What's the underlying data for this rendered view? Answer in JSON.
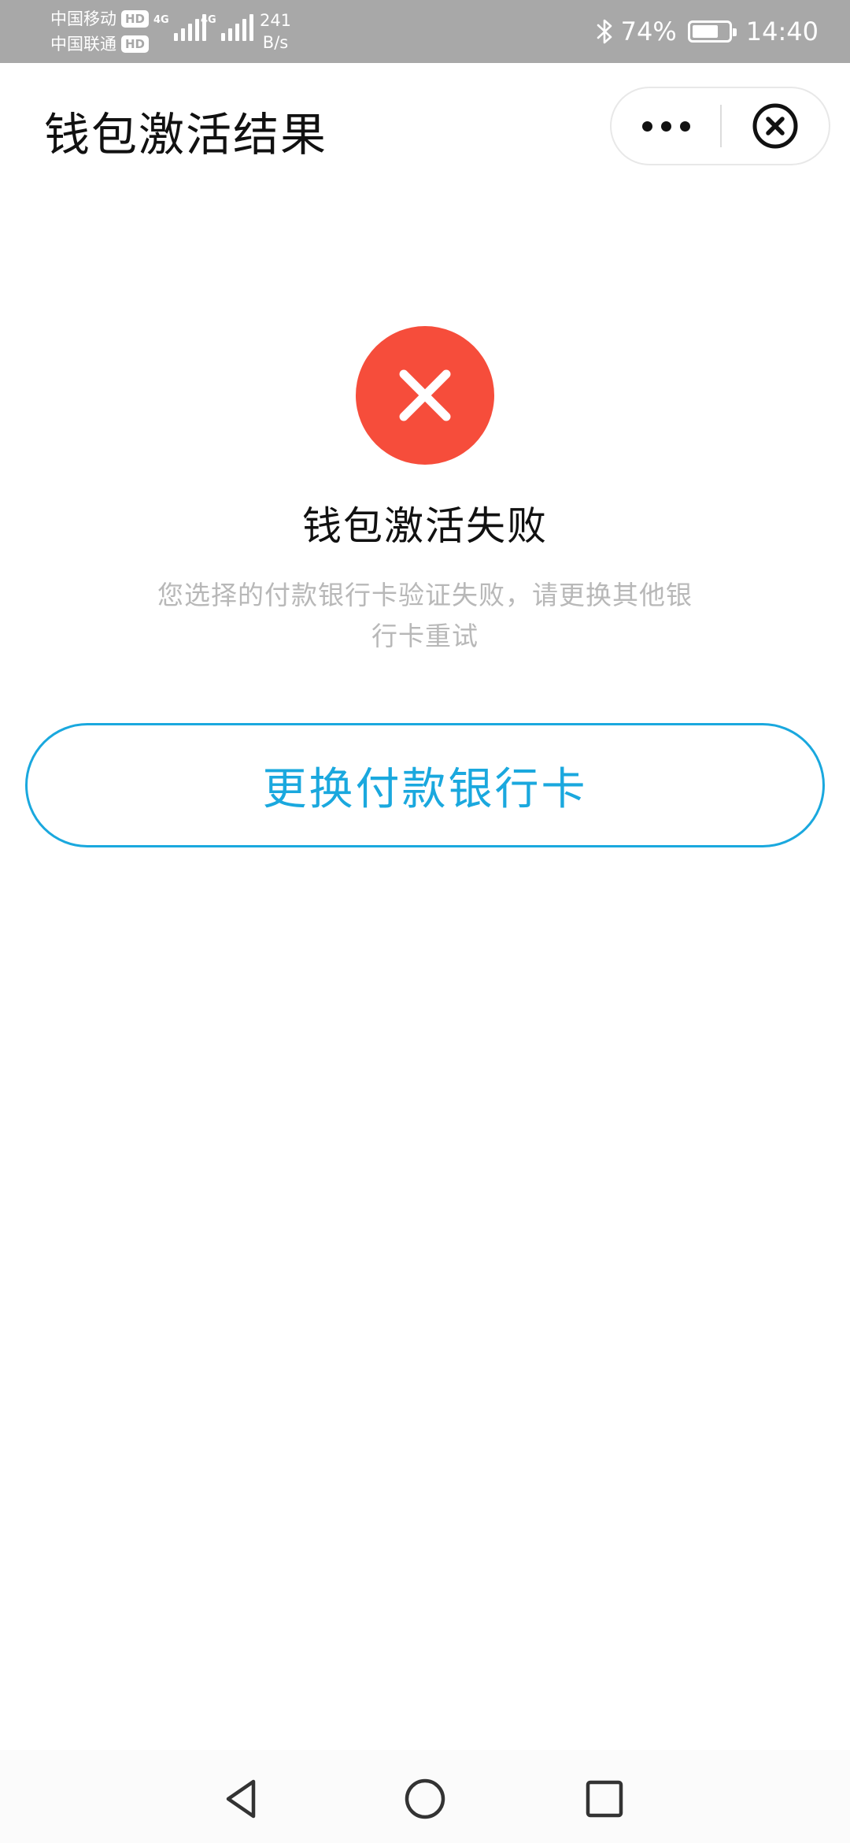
{
  "status_bar": {
    "carrier_1": "中国移动",
    "carrier_2": "中国联通",
    "hd_badge": "HD",
    "network_1": "4G",
    "network_2": "4G",
    "speed_value": "241",
    "speed_unit": "B/s",
    "battery_level": 0.74,
    "battery_text": "74%",
    "time": "14:40"
  },
  "title_bar": {
    "title": "钱包激活结果",
    "more_icon": "more-dots-icon",
    "close_icon": "close-circle-icon"
  },
  "result": {
    "status_icon": "error-cross-icon",
    "status_color": "#f64d3b",
    "title": "钱包激活失败",
    "description": "您选择的付款银行卡验证失败，请更换其他银行卡重试"
  },
  "actions": {
    "change_card_label": "更换付款银行卡",
    "accent_color": "#1aa8de"
  },
  "nav_bar": {
    "back_icon": "triangle-back-icon",
    "home_icon": "circle-home-icon",
    "recent_icon": "square-recent-icon"
  }
}
